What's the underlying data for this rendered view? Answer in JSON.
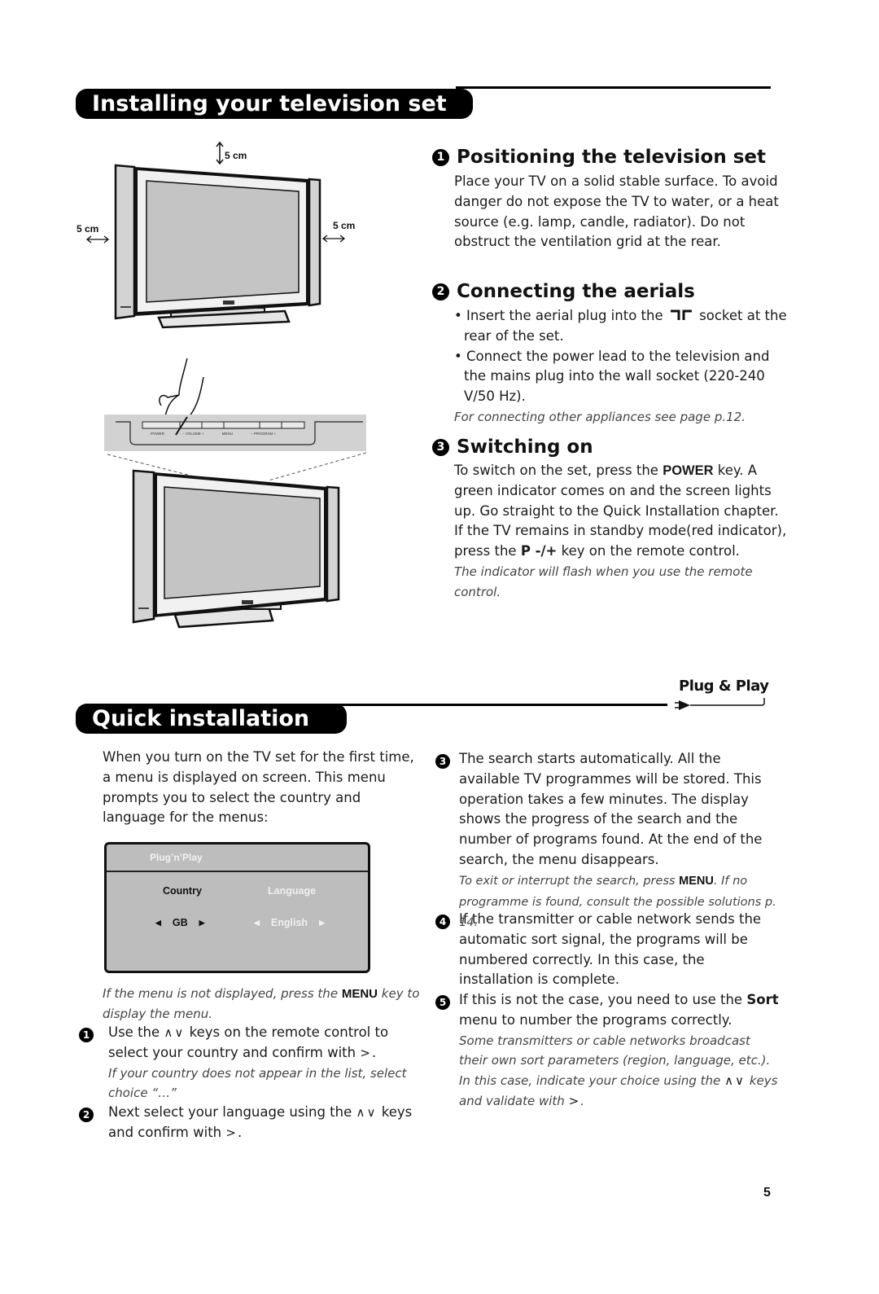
{
  "section1": {
    "title": "Installing your television set",
    "illustration": {
      "dimension_top": "5 cm",
      "dimension_left": "5 cm",
      "dimension_right": "5 cm",
      "panel_buttons": [
        "POWER",
        "− VOLUME +",
        "MENU",
        "− PROGRAM +"
      ]
    },
    "positioning": {
      "number": "1",
      "heading": "Positioning the television set",
      "text": "Place your TV on a solid stable surface. To avoid danger do not expose the TV to water, or a heat source (e.g. lamp, candle, radiator). Do not obstruct the ventilation grid at the rear."
    },
    "aerials": {
      "number": "2",
      "heading": "Connecting the aerials",
      "bullet1_pre": "Insert the aerial plug into the",
      "bullet1_icon": "aerial-socket-icon",
      "bullet1_post": "socket at the rear of the set.",
      "bullet2": "Connect the power lead to the television and the mains plug into the wall socket (220-240 V/50 Hz).",
      "note": "For connecting other appliances see page p.12."
    },
    "switching": {
      "number": "3",
      "heading": "Switching on",
      "text_pre": "To switch on the set, press the",
      "power_key": "POWER",
      "text_mid": "key. A green indicator comes on and the screen lights up. Go straight to the Quick Installation chapter. If the TV remains in standby mode(red indicator), press the",
      "p_key": "P -/+",
      "text_post": "key on the remote control.",
      "note": "The indicator will flash when you use the remote control."
    }
  },
  "section2": {
    "title": "Quick installation",
    "logo": "Plug & Play",
    "intro": "When you turn on the TV set for the first time, a menu is displayed on screen. This menu prompts you to select the country and language for the menus:",
    "osd": {
      "title": "Plug’n’Play",
      "country_label": "Country",
      "country_value": "GB",
      "language_label": "Language",
      "language_value": "English"
    },
    "menu_note_pre": "If the menu is not displayed, press the",
    "menu_key": "MENU",
    "menu_note_post": "key to display the menu.",
    "steps": [
      {
        "number": "1",
        "text_pre": "Use the",
        "keys": "∧∨",
        "text_post": "keys on the remote control to select your country and confirm with",
        "confirm": ">",
        "note": "If your country does not appear in the list, select choice “…”"
      },
      {
        "number": "2",
        "text_pre": "Next select your language using the",
        "keys": "∧∨",
        "text_post": "keys and confirm with",
        "confirm": ">"
      },
      {
        "number": "3",
        "text": "The search starts automatically. All the available TV programmes will be stored. This operation takes a few minutes. The display shows the progress of the search and the number of programs found. At the end of the search, the menu disappears.",
        "note_pre": "To exit or interrupt the search, press",
        "note_key": "MENU",
        "note_post": ". If no programme is found, consult the possible solutions p. 14."
      },
      {
        "number": "4",
        "text": "If the transmitter or cable network sends the automatic sort signal, the programs will be numbered correctly. In this case, the installation is complete."
      },
      {
        "number": "5",
        "text_pre": "If this is not the case, you need to use the",
        "sort_key": "Sort",
        "text_post": "menu to number the programs correctly.",
        "note_pre": "Some transmitters or cable networks broadcast their own sort parameters (region, language, etc.). In this case, indicate your choice using the",
        "note_keys": "∧∨",
        "note_mid": "keys and validate with",
        "note_confirm": ">"
      }
    ]
  },
  "page_number": "5"
}
